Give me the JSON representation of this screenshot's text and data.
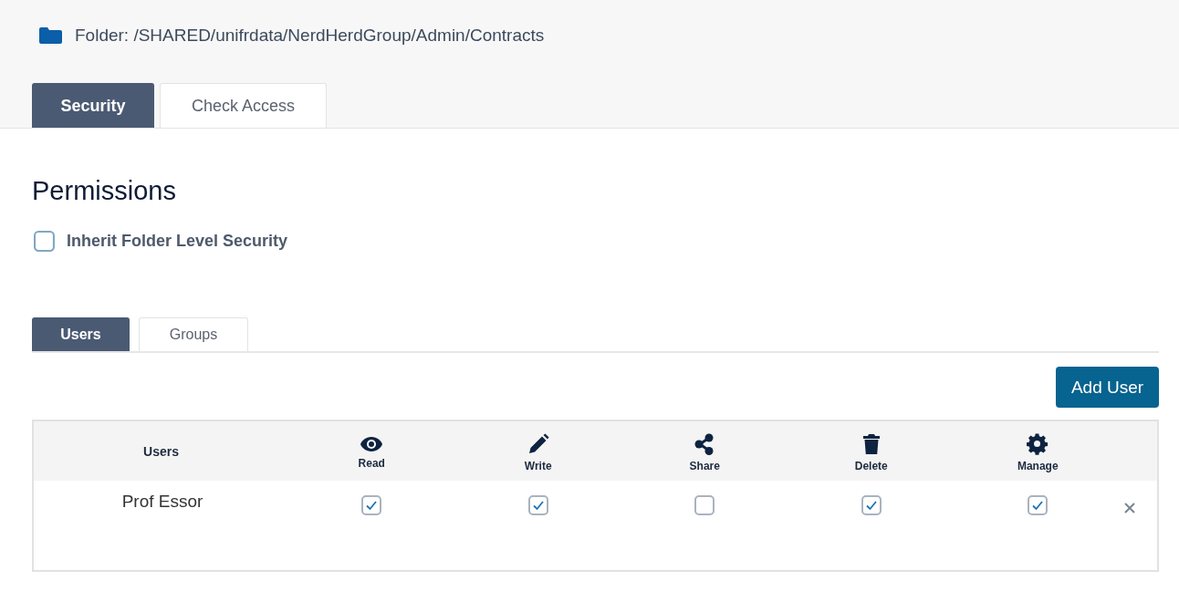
{
  "folder": {
    "label": "Folder: /SHARED/unifrdata/NerdHerdGroup/Admin/Contracts"
  },
  "tabs": [
    {
      "label": "Security",
      "selected": true
    },
    {
      "label": "Check Access",
      "selected": false
    }
  ],
  "heading": "Permissions",
  "inherit": {
    "label": "Inherit Folder Level Security",
    "checked": false
  },
  "subtabs": [
    {
      "label": "Users",
      "selected": true
    },
    {
      "label": "Groups",
      "selected": false
    }
  ],
  "add_button": "Add User",
  "table": {
    "user_column": "Users",
    "columns": [
      {
        "label": "Read"
      },
      {
        "label": "Write"
      },
      {
        "label": "Share"
      },
      {
        "label": "Delete"
      },
      {
        "label": "Manage"
      }
    ],
    "rows": [
      {
        "name": "Prof Essor",
        "permissions": [
          {
            "checked": true
          },
          {
            "checked": true
          },
          {
            "checked": false
          },
          {
            "checked": true
          },
          {
            "checked": true
          }
        ]
      }
    ]
  }
}
